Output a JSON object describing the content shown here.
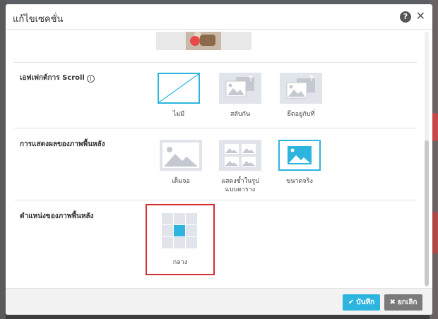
{
  "dialog": {
    "title": "แก้ไขเซคชั่น",
    "help_icon": "question-circle-icon",
    "help_glyph": "?",
    "close_icon": "close-icon",
    "close_glyph": "✕"
  },
  "sections": {
    "scroll_effect": {
      "label": "เอฟเฟกต์การ Scroll",
      "info_glyph": "i",
      "options": [
        {
          "label": "ไม่มี",
          "icon": "diagonal-line-icon",
          "selected": true
        },
        {
          "label": "สลับกัน",
          "icon": "parallax-images-icon",
          "selected": false
        },
        {
          "label": "ยึดอยู่กับที่",
          "icon": "fixed-images-icon",
          "selected": false
        }
      ]
    },
    "background_display": {
      "label": "การแสดงผลของภาพพื้นหลัง",
      "options": [
        {
          "label": "เต็มจอ",
          "icon": "fill-image-icon",
          "selected": false
        },
        {
          "label": "แสดงซ้ำในรูปแบบตาราง",
          "label_line1": "แสดงซ้ำในรูป",
          "label_line2": "แบบตาราง",
          "icon": "tile-images-icon",
          "selected": false
        },
        {
          "label": "ขนาดจริง",
          "icon": "actual-size-image-icon",
          "selected": true
        }
      ]
    },
    "background_position": {
      "label": "ตำแหน่งของภาพพื้นหลัง",
      "selected_label": "กลาง",
      "grid": [
        [
          false,
          false,
          false
        ],
        [
          false,
          true,
          false
        ],
        [
          false,
          false,
          false
        ]
      ]
    }
  },
  "footer": {
    "save_label": "บันทึก",
    "save_glyph": "✔",
    "cancel_label": "ยกเลิก",
    "cancel_glyph": "✖"
  },
  "colors": {
    "accent": "#2db5e0",
    "highlight_border": "#d32f2f",
    "option_bg": "#e1e4ea",
    "cancel_bg": "#7a7a7a"
  }
}
